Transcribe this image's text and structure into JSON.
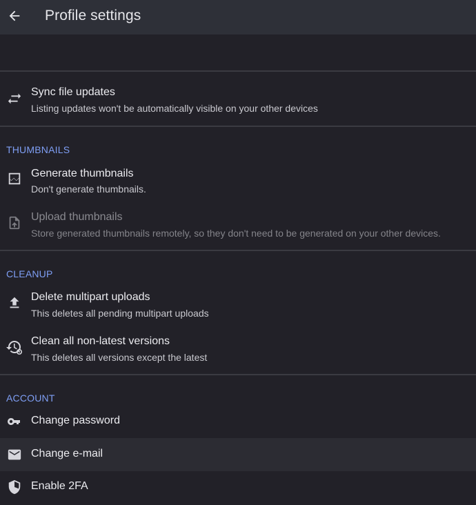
{
  "header": {
    "title": "Profile settings",
    "back_icon": "arrow-left-icon"
  },
  "sync": {
    "title": "Sync file updates",
    "subtitle": "Listing updates won't be automatically visible on your other devices",
    "icon": "swap-arrows-icon"
  },
  "sections": {
    "thumbnails": "THUMBNAILS",
    "cleanup": "CLEANUP",
    "account": "ACCOUNT"
  },
  "thumbnails": {
    "generate": {
      "title": "Generate thumbnails",
      "subtitle": "Don't generate thumbnails.",
      "icon": "image-icon"
    },
    "upload": {
      "title": "Upload thumbnails",
      "subtitle": "Store generated thumbnails remotely, so they don't need to be generated on your other devices.",
      "icon": "file-upload-icon"
    }
  },
  "cleanup": {
    "multipart": {
      "title": "Delete multipart uploads",
      "subtitle": "This deletes all pending multipart uploads",
      "icon": "upload-icon"
    },
    "versions": {
      "title": "Clean all non-latest versions",
      "subtitle": "This deletes all versions except the latest",
      "icon": "history-settings-icon"
    }
  },
  "account": {
    "password": {
      "title": "Change password",
      "icon": "key-icon"
    },
    "email": {
      "title": "Change e-mail",
      "icon": "mail-icon"
    },
    "twofa": {
      "title": "Enable 2FA",
      "icon": "shield-icon"
    }
  },
  "colors": {
    "accent": "#7f9ff5",
    "background": "#222128",
    "appbar": "#2e3038"
  }
}
